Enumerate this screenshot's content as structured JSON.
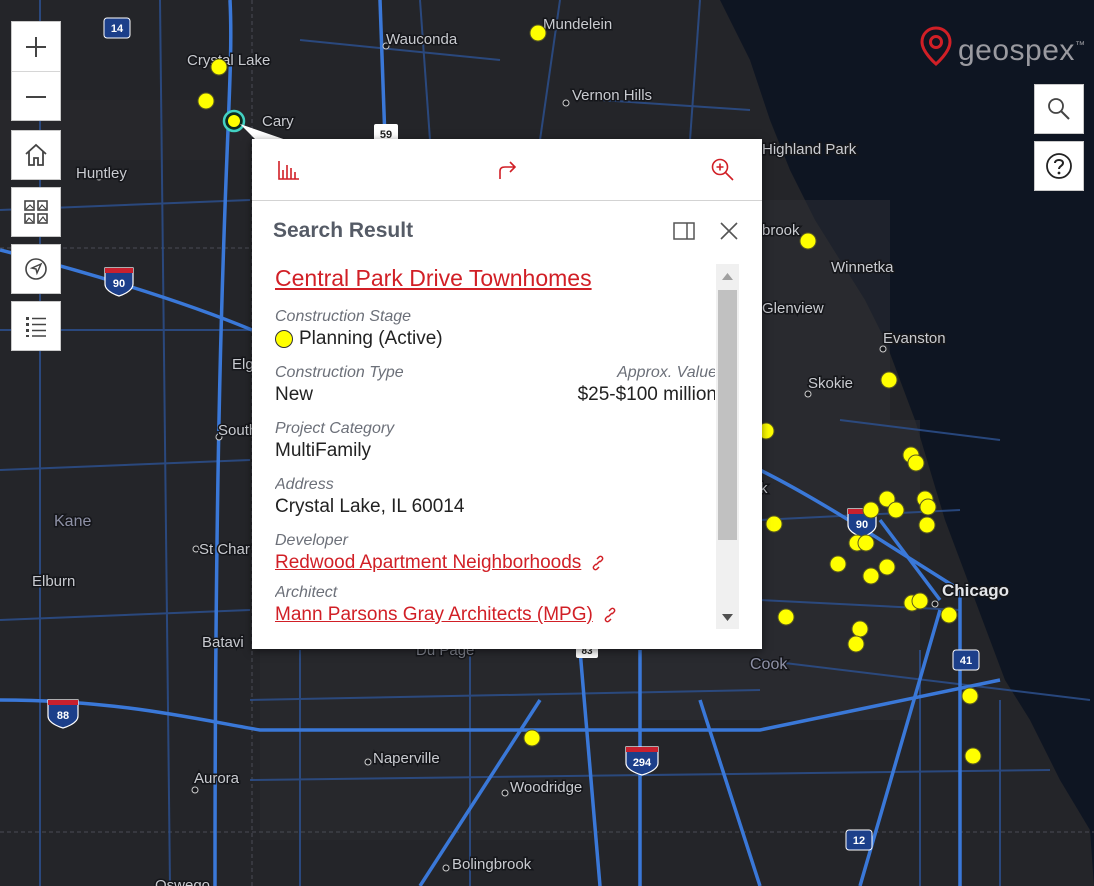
{
  "brand": {
    "name": "geospex",
    "tm": "™",
    "color": "#d11f26"
  },
  "toolbar": {
    "zoom_in_icon": "plus-icon",
    "zoom_out_icon": "minus-icon",
    "home_icon": "home-icon",
    "basemap_icon": "basemap-gallery-icon",
    "locate_icon": "locate-arrow-icon",
    "legend_icon": "legend-list-icon",
    "search_icon": "search-icon",
    "help_icon": "help-icon"
  },
  "map": {
    "places": [
      {
        "name": "Mundelein"
      },
      {
        "name": "Wauconda"
      },
      {
        "name": "Crystal Lake"
      },
      {
        "name": "Vernon Hills"
      },
      {
        "name": "Cary"
      },
      {
        "name": "Highland Park"
      },
      {
        "name": "Huntley"
      },
      {
        "name": "brook"
      },
      {
        "name": "Winnetka"
      },
      {
        "name": "Glenview"
      },
      {
        "name": "Evanston"
      },
      {
        "name": "Skokie"
      },
      {
        "name": "Elg"
      },
      {
        "name": "South"
      },
      {
        "name": "Kane"
      },
      {
        "name": "St Char"
      },
      {
        "name": "Elburn"
      },
      {
        "name": "Batavi"
      },
      {
        "name": "rk"
      },
      {
        "name": "Chicago"
      },
      {
        "name": "Cook"
      },
      {
        "name": "Du Page"
      },
      {
        "name": "Naperville"
      },
      {
        "name": "Aurora"
      },
      {
        "name": "Woodridge"
      },
      {
        "name": "Bolingbrook"
      },
      {
        "name": "Oswego"
      }
    ],
    "shields": [
      "14",
      "59",
      "90",
      "90",
      "88",
      "294",
      "41",
      "12",
      "83"
    ],
    "marker_color": "#ffff00"
  },
  "popup": {
    "actions": {
      "statistics_icon": "bar-chart-icon",
      "directions_icon": "share-arrow-icon",
      "zoom_to_icon": "zoom-in-icon"
    },
    "title": "Search Result",
    "dock_icon": "dock-panel-icon",
    "close_icon": "close-icon",
    "project_name": "Central Park Drive Townhomes",
    "stage_label": "Construction Stage",
    "stage_value": "Planning (Active)",
    "stage_color": "#ffff00",
    "type_label": "Construction Type",
    "type_value": "New",
    "value_label": "Approx. Value",
    "value_value": "$25-$100 million",
    "category_label": "Project Category",
    "category_value": "MultiFamily",
    "address_label": "Address",
    "address_value": "Crystal Lake, IL 60014",
    "developer_label": "Developer",
    "developer_value": "Redwood Apartment Neighborhoods",
    "architect_label": "Architect",
    "architect_value": "Mann Parsons Gray Architects (MPG)",
    "link_icon": "link-icon"
  }
}
